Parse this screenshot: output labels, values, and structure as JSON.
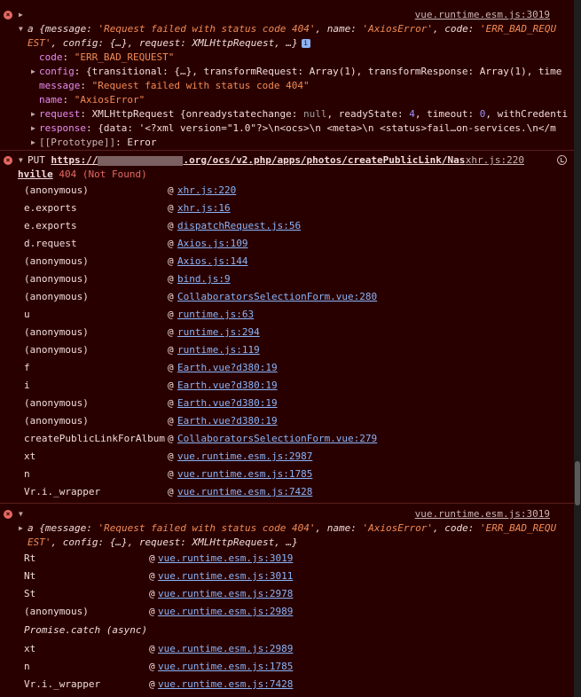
{
  "messages": {
    "m1": {
      "source": "vue.runtime.esm.js:3019",
      "summary": {
        "class": "a",
        "k1": "message",
        "v1": "'Request failed with status code 404'",
        "k2": "name",
        "v2": "'AxiosError'",
        "k3": "code",
        "v3": "'ERR_BAD_REQU",
        "v3b": "EST'",
        "k4": "config",
        "v4": "{…}",
        "k5": "request",
        "v5": "XMLHttpRequest",
        "tail": "…}",
        "info_badge": "i"
      },
      "props": {
        "code_key": "code",
        "code_val": "\"ERR_BAD_REQUEST\"",
        "config_key": "config",
        "config_val": "{transitional: {…}, transformRequest: Array(1), transformResponse: Array(1), time",
        "message_key": "message",
        "message_val": "\"Request failed with status code 404\"",
        "name_key": "name",
        "name_val": "\"AxiosError\"",
        "request_key": "request",
        "request_val_a": "XMLHttpRequest {onreadystatechange: ",
        "request_null": "null",
        "request_val_b": ", readyState: ",
        "request_num1": "4",
        "request_val_c": ", timeout: ",
        "request_num2": "0",
        "request_val_d": ", withCredenti",
        "response_key": "response",
        "response_val": "{data: '<?xml version=\"1.0\"?>\\n<ocs>\\n <meta>\\n  <status>fail…on-services.\\n</m",
        "proto_key": "[[Prototype]]",
        "proto_val": "Error"
      }
    },
    "m2": {
      "method": "PUT",
      "url_start": "https://",
      "url_mid": ".org/ocs/v2.php/apps/photos/createPublicLink/Nash",
      "url_end": "ville",
      "status": "404 (Not Found)",
      "source": "xhr.js:220",
      "stack": [
        {
          "fn": "(anonymous)",
          "loc": "xhr.js:220"
        },
        {
          "fn": "e.exports",
          "loc": "xhr.js:16"
        },
        {
          "fn": "e.exports",
          "loc": "dispatchRequest.js:56"
        },
        {
          "fn": "d.request",
          "loc": "Axios.js:109"
        },
        {
          "fn": "(anonymous)",
          "loc": "Axios.js:144"
        },
        {
          "fn": "(anonymous)",
          "loc": "bind.js:9"
        },
        {
          "fn": "(anonymous)",
          "loc": "CollaboratorsSelectionForm.vue:280"
        },
        {
          "fn": "u",
          "loc": "runtime.js:63"
        },
        {
          "fn": "(anonymous)",
          "loc": "runtime.js:294"
        },
        {
          "fn": "(anonymous)",
          "loc": "runtime.js:119"
        },
        {
          "fn": "f",
          "loc": "Earth.vue?d380:19"
        },
        {
          "fn": "i",
          "loc": "Earth.vue?d380:19"
        },
        {
          "fn": "(anonymous)",
          "loc": "Earth.vue?d380:19"
        },
        {
          "fn": "(anonymous)",
          "loc": "Earth.vue?d380:19"
        },
        {
          "fn": "createPublicLinkForAlbum",
          "loc": "CollaboratorsSelectionForm.vue:279"
        },
        {
          "fn": "xt",
          "loc": "vue.runtime.esm.js:2987"
        },
        {
          "fn": "n",
          "loc": "vue.runtime.esm.js:1785"
        },
        {
          "fn": "Vr.i._wrapper",
          "loc": "vue.runtime.esm.js:7428"
        }
      ]
    },
    "m3": {
      "source": "vue.runtime.esm.js:3019",
      "summary": {
        "class": "a",
        "k1": "message",
        "v1": "'Request failed with status code 404'",
        "k2": "name",
        "v2": "'AxiosError'",
        "k3": "code",
        "v3": "'ERR_BAD_REQU",
        "v3b": "EST'",
        "k4": "config",
        "v4": "{…}",
        "k5": "request",
        "v5": "XMLHttpRequest",
        "tail": "…}"
      },
      "stack": [
        {
          "fn": "Rt",
          "loc": "vue.runtime.esm.js:3019"
        },
        {
          "fn": "Nt",
          "loc": "vue.runtime.esm.js:3011"
        },
        {
          "fn": "St",
          "loc": "vue.runtime.esm.js:2978"
        },
        {
          "fn": "(anonymous)",
          "loc": "vue.runtime.esm.js:2989"
        }
      ],
      "async_label": "Promise.catch (async)",
      "stack2": [
        {
          "fn": "xt",
          "loc": "vue.runtime.esm.js:2989"
        },
        {
          "fn": "n",
          "loc": "vue.runtime.esm.js:1785"
        },
        {
          "fn": "Vr.i._wrapper",
          "loc": "vue.runtime.esm.js:7428"
        }
      ]
    }
  },
  "at_sign": "@",
  "glyphs": {
    "error": "×",
    "collapsed": "▶",
    "expanded": "▼"
  },
  "colors": {
    "background": "#290000",
    "error_red": "#e46962",
    "link_blue": "#8ab4f8",
    "string_orange": "#f28b54",
    "prop_pink": "#e78bf0"
  }
}
